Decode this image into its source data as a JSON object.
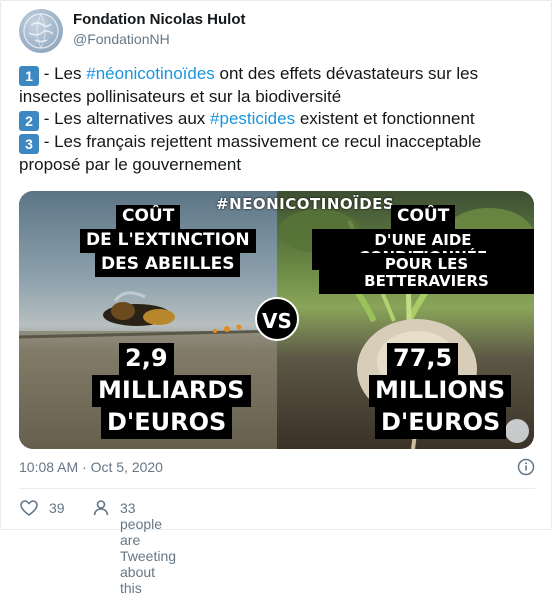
{
  "author": {
    "name": "Fondation Nicolas Hulot",
    "handle": "@FondationNH"
  },
  "tweet": {
    "lines": [
      {
        "num": "1",
        "pre": " - Les ",
        "tag": "#néonicotinoïdes",
        "post": " ont des effets dévastateurs sur les"
      },
      {
        "text": "insectes pollinisateurs et sur la biodiversité"
      },
      {
        "num": "2",
        "pre": " - Les alternatives aux ",
        "tag": "#pesticides",
        "post": " existent et fonctionnent"
      },
      {
        "num": "3",
        "pre": " - Les français rejettent massivement ce recul inacceptable",
        "tag": "",
        "post": ""
      },
      {
        "text": "proposé par le gouvernement"
      }
    ]
  },
  "media": {
    "hashtag_overlay": "#NEONICOTINOÏDES",
    "left": {
      "title": [
        "COÛT",
        "DE L'EXTINCTION",
        "DES ABEILLES"
      ],
      "value": "2,9",
      "unit": [
        "MILLIARDS",
        "D'EUROS"
      ]
    },
    "vs": "VS",
    "right": {
      "title": [
        "COÛT",
        "D'UNE AIDE CONDITIONNÉE",
        "POUR LES BETTERAVIERS"
      ],
      "value": "77,5",
      "unit": [
        "MILLIONS",
        "D'EUROS"
      ]
    }
  },
  "meta": {
    "timestamp": "10:08 AM · Oct 5, 2020"
  },
  "footer": {
    "likes": "39",
    "tweeting": "33 people are Tweeting about this"
  },
  "colors": {
    "hashtag": "#1b95e0",
    "keycap": "#3b88c3",
    "secondary_text": "#657786"
  },
  "icons": {
    "info": "info-circle-icon",
    "like": "heart-icon",
    "tweeting": "person-icon"
  }
}
